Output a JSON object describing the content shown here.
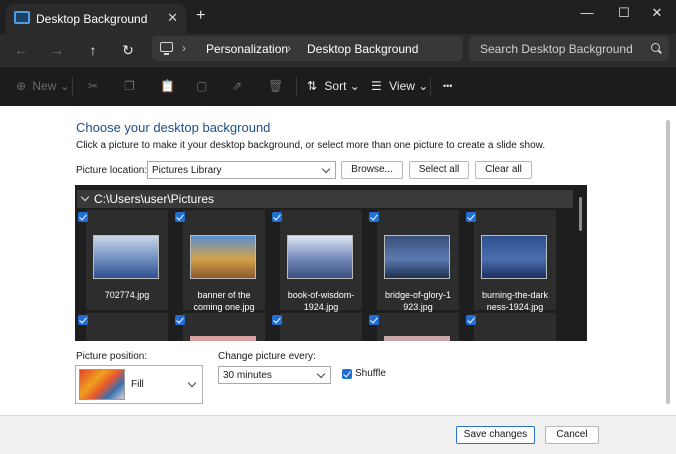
{
  "window": {
    "tab_title": "Desktop Background",
    "tab_close": "✕",
    "new_tab": "+",
    "minimize": "—",
    "maximize": "☐",
    "close": "✕"
  },
  "nav": {
    "back": "←",
    "forward": "→",
    "up": "↑",
    "refresh": "↻"
  },
  "breadcrumb": {
    "items": [
      "Personalization",
      "Desktop Background"
    ],
    "separator": "›"
  },
  "search": {
    "placeholder": "Search Desktop Background"
  },
  "toolbar": {
    "new_label": "New",
    "sort_label": "Sort",
    "view_label": "View",
    "more_label": "•••",
    "icons": {
      "new": "⊕",
      "cut": "✂",
      "copy": "❐",
      "paste": "📋",
      "rename": "▢",
      "share": "⇗",
      "delete": "🗑",
      "sort": "⇅",
      "view": "☰",
      "dropdown": "⌄"
    }
  },
  "content": {
    "heading": "Choose your desktop background",
    "description": "Click a picture to make it your desktop background, or select more than one picture to create a slide show.",
    "picture_location_label": "Picture location:",
    "picture_location_value": "Pictures Library",
    "browse_label": "Browse...",
    "select_all_label": "Select all",
    "clear_all_label": "Clear all",
    "group_title": "C:\\Users\\user\\Pictures",
    "pictures": [
      {
        "caption_1": "702774.jpg",
        "caption_2": "",
        "colors": [
          "#c9d6e8",
          "#6f8fc0",
          "#2f4f8e"
        ],
        "checked": true
      },
      {
        "caption_1": "banner of the",
        "caption_2": "coming one.jpg",
        "colors": [
          "#5a8fd1",
          "#d4a14a",
          "#8a5a2e"
        ],
        "checked": true
      },
      {
        "caption_1": "book-of-wisdom-",
        "caption_2": "1924.jpg",
        "colors": [
          "#dfe6f2",
          "#7088b8",
          "#3c4f80"
        ],
        "checked": true
      },
      {
        "caption_1": "bridge-of-glory-1",
        "caption_2": "923.jpg",
        "colors": [
          "#3a4f7a",
          "#5a7ab0",
          "#1e2f52"
        ],
        "checked": true
      },
      {
        "caption_1": "burning-the-dark",
        "caption_2": "ness-1924.jpg",
        "colors": [
          "#2f4f8e",
          "#4a6fb0",
          "#1d2f60"
        ],
        "checked": true
      }
    ],
    "picture_position_label": "Picture position:",
    "picture_position_value": "Fill",
    "change_every_label": "Change picture every:",
    "change_every_value": "30 minutes",
    "shuffle_label": "Shuffle",
    "shuffle_checked": true
  },
  "footer": {
    "save_label": "Save changes",
    "cancel_label": "Cancel"
  }
}
